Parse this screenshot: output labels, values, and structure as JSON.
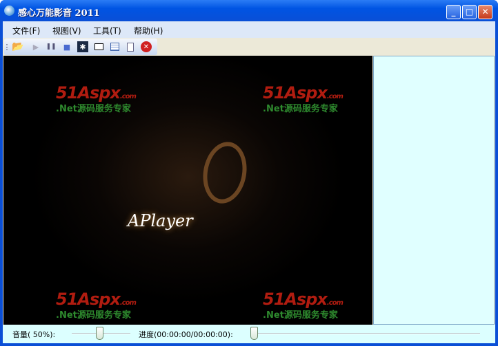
{
  "window": {
    "title": "感心万能影音 2011",
    "minimize": "_",
    "maximize": "□",
    "close": "✕"
  },
  "menu": [
    "文件(F)",
    "视图(V)",
    "工具(T)",
    "帮助(H)"
  ],
  "toolbar": [
    "open-folder-icon",
    "play-icon",
    "pause-icon",
    "stop-icon",
    "pin-icon",
    "window-icon",
    "list-icon",
    "document-icon",
    "exit-icon"
  ],
  "video": {
    "logo": "APlayer",
    "watermark": {
      "brand": "51Aspx",
      "domain": ".com",
      "slogan": ".Net源码服务专家"
    }
  },
  "controls": {
    "volume_label": "音量( 50%):",
    "volume_percent": 50,
    "progress_label": "进度(00:00:00/00:00:00):",
    "progress_percent": 0
  },
  "colors": {
    "title": "#0054e3",
    "panel": "#e0ffff"
  }
}
